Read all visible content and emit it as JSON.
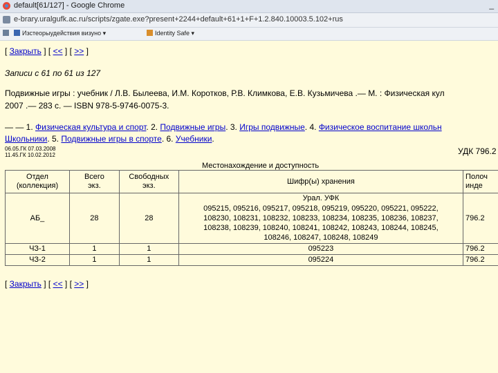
{
  "window": {
    "title": "default[61/127] - Google Chrome",
    "minimize": "_"
  },
  "address": {
    "url": "e-brary.uralgufk.ac.ru/scripts/zgate.exe?present+2244+default+61+1+F+1.2.840.10003.5.102+rus"
  },
  "bookmarks": [
    {
      "label": ""
    },
    {
      "label": "Изстеорыудействия визуно"
    },
    {
      "label": "Identity Safe"
    }
  ],
  "nav": {
    "close": "Закрыть",
    "prev": "<<",
    "next": ">>"
  },
  "records_label": "Записи с 61 по 61 из 127",
  "citation": {
    "line1": "Подвижные игры : учебник / Л.В. Былеева, И.М. Коротков, Р.В. Климкова, Е.В. Кузьмичева .— М. : Физическая кул",
    "line2": "2007 .— 283 с. — ISBN 978-5-9746-0075-3."
  },
  "subjects": {
    "prefix": "— — 1. ",
    "s1": "Физическая культура и спорт",
    "sep2": ". 2. ",
    "s2": "Подвижные игры",
    "sep3": ". 3. ",
    "s3": "Игры подвижные",
    "sep4": ". 4. ",
    "s4a": "Физическое воспитание школьн",
    "s4b": "Школьники",
    "sep5": ". 5. ",
    "s5": "Подвижные игры в спорте",
    "sep6": ". 6. ",
    "s6": "Учебники",
    "end": "."
  },
  "dates": {
    "d1": "06.05.ГК 07.03.2008",
    "d2": "11.45.ГК 10.02.2012"
  },
  "udk": "УДК 796.2",
  "location_title": "Местонахождение и доступность",
  "holdings": {
    "headers": {
      "dept": [
        "Отдел",
        "(коллекция)"
      ],
      "total": [
        "Всего",
        "экз."
      ],
      "free": [
        "Свободных",
        "экз."
      ],
      "shelf": "Шифр(ы) хранения",
      "pol": [
        "Полоч",
        "инде"
      ]
    },
    "sub_label": "Урал. УФК",
    "rows": [
      {
        "dept": "АБ_",
        "total": "28",
        "free": "28",
        "shelf": [
          "095215, 095216, 095217, 095218, 095219, 095220, 095221, 095222,",
          "108230, 108231, 108232, 108233, 108234, 108235, 108236, 108237,",
          "108238, 108239, 108240, 108241, 108242, 108243, 108244, 108245,",
          "108246, 108247, 108248, 108249"
        ],
        "pol": "796.2"
      },
      {
        "dept": "ЧЗ-1",
        "total": "1",
        "free": "1",
        "shelf": [
          "095223"
        ],
        "pol": "796.2"
      },
      {
        "dept": "ЧЗ-2",
        "total": "1",
        "free": "1",
        "shelf": [
          "095224"
        ],
        "pol": "796.2"
      }
    ]
  }
}
